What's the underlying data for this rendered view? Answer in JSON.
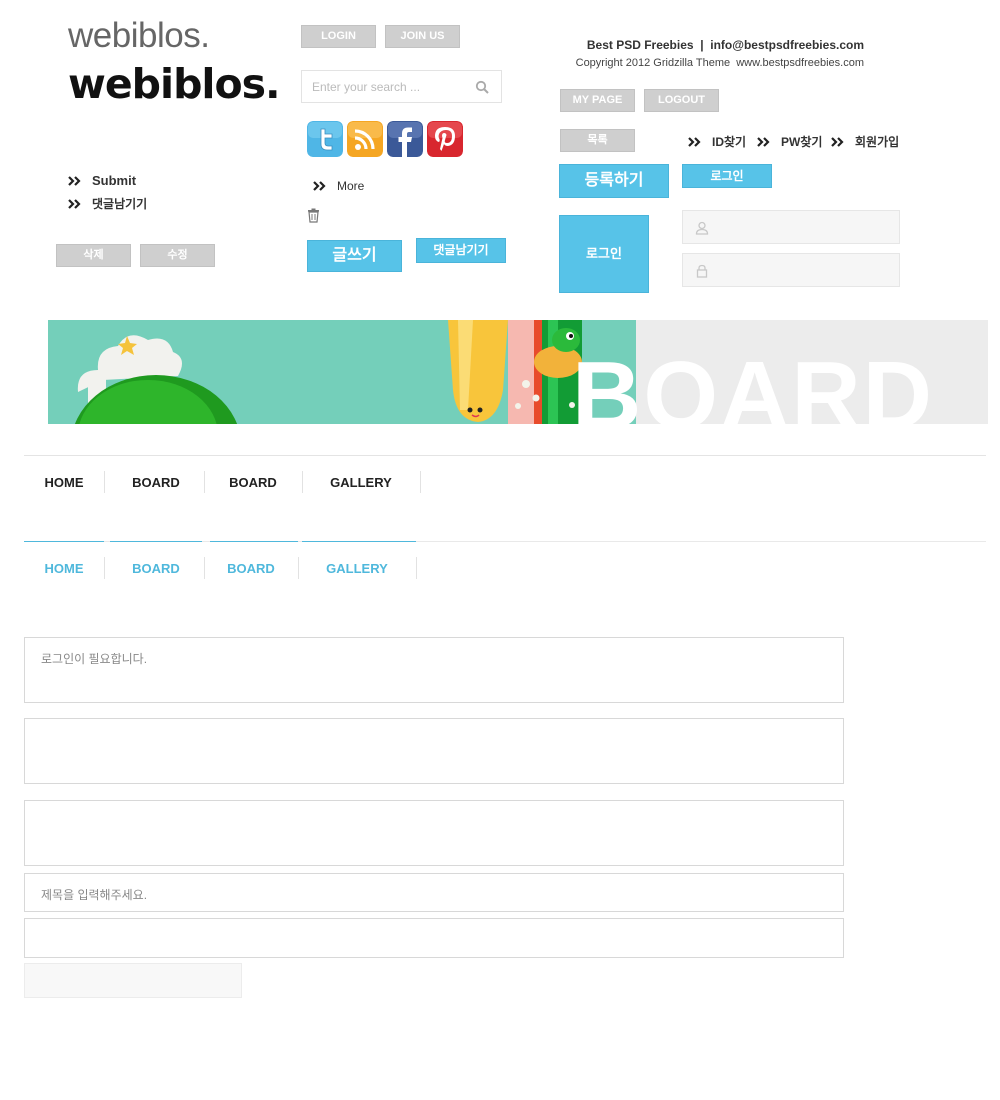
{
  "logo": {
    "text_light": "webiblos.",
    "text_bold": "webiblos."
  },
  "buttons": {
    "login": "LOGIN",
    "join_us": "JOIN US",
    "my_page": "MY PAGE",
    "logout": "LOGOUT",
    "delete": "삭제",
    "edit": "수정",
    "list": "목록",
    "write": "글쓰기",
    "comment": "댓글남기기",
    "register": "등록하기",
    "login_small": "로그인",
    "login_big": "로그인"
  },
  "links": {
    "submit": "Submit",
    "leave_comment": "댓글남기기",
    "more": "More",
    "find_id": "ID찾기",
    "find_pw": "PW찾기",
    "signup": "회원가입"
  },
  "search": {
    "placeholder": "Enter your search ..."
  },
  "social": [
    "twitter-icon",
    "rss-icon",
    "facebook-icon",
    "pinterest-icon"
  ],
  "footer_info": {
    "line1": "Best PSD Freebies  |  info@bestpsdfreebies.com",
    "line2": "Copyright 2012 Gridzilla Theme  www.bestpsdfreebies.com"
  },
  "banner": {
    "word": "BOARD"
  },
  "nav_dark": [
    "HOME",
    "BOARD",
    "BOARD",
    "GALLERY"
  ],
  "nav_blue": [
    "HOME",
    "BOARD",
    "BOARD",
    "GALLERY"
  ],
  "form": {
    "login_required": "로그인이 필요합니다.",
    "title_placeholder": "제목을 입력해주세요."
  },
  "colors": {
    "accent_blue": "#57c3e8",
    "gray_button": "#cfcfcf",
    "nav_blue_text": "#4fb8dc"
  }
}
